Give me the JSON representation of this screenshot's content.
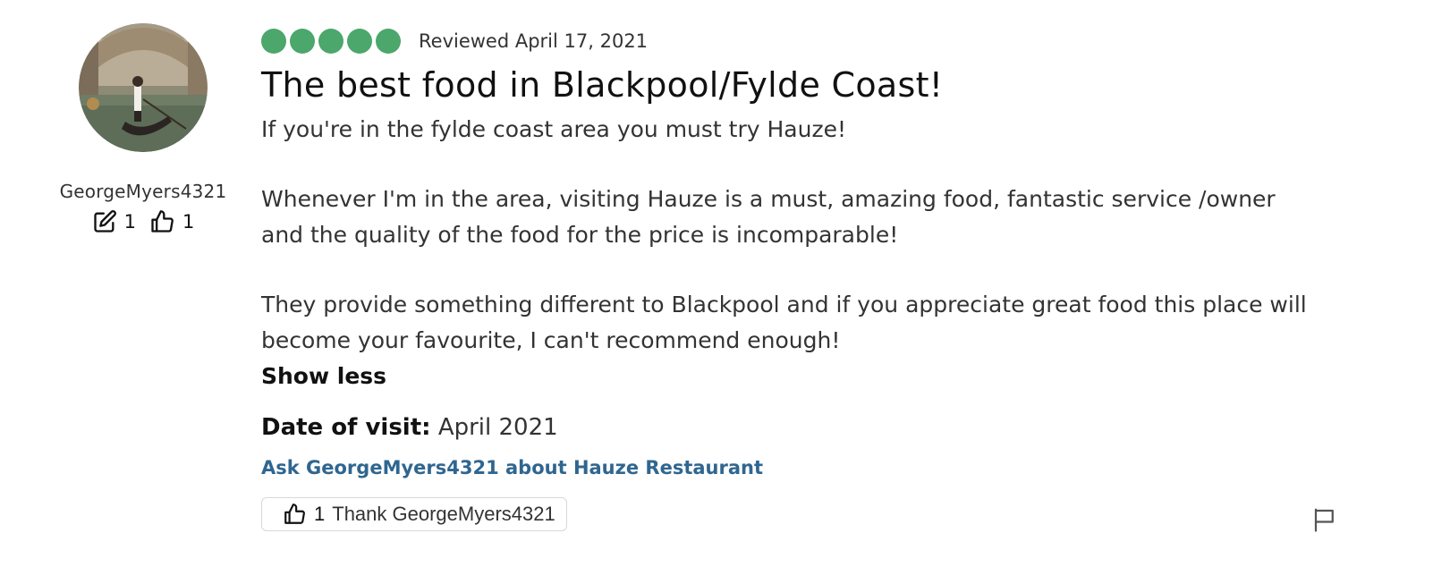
{
  "reviewer": {
    "username": "GeorgeMyers4321",
    "contributions": "1",
    "helpful_votes": "1",
    "avatar_icon": "gondola-photo"
  },
  "review": {
    "rating": 5,
    "rating_color": "#4ba76b",
    "reviewed_date": "Reviewed April 17, 2021",
    "title": "The best food in Blackpool/Fylde Coast!",
    "paragraphs": [
      "If you're in the fylde coast area you must try Hauze!",
      "Whenever I'm in the area, visiting Hauze is a must, amazing food, fantastic service /owner and the quality of the food for the price is incomparable!",
      "They provide something different to Blackpool and if you appreciate great food this place will become your favourite, I can't recommend enough!"
    ],
    "show_less_label": "Show less",
    "date_of_visit_label": "Date of visit:",
    "date_of_visit_value": "April 2021",
    "ask_link": "Ask GeorgeMyers4321 about Hauze Restaurant",
    "thank_count": "1",
    "thank_label": "Thank GeorgeMyers4321",
    "link_color": "#2f6690"
  }
}
